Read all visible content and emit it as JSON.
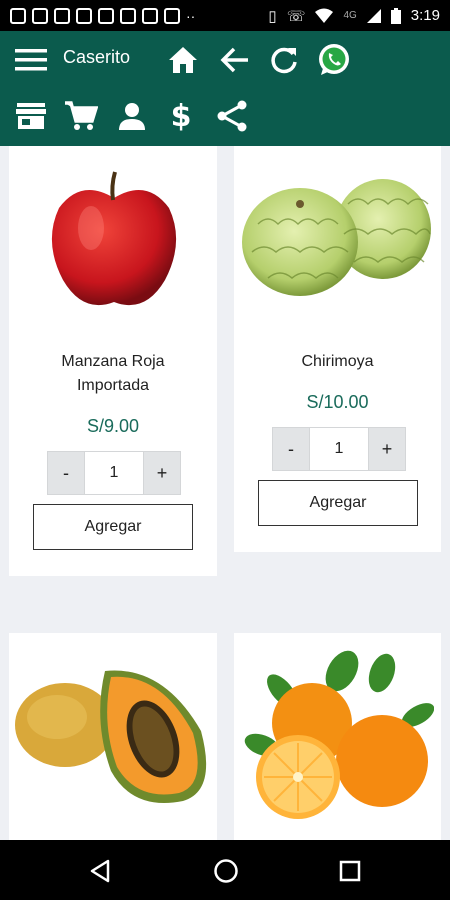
{
  "status_bar": {
    "time": "3:19",
    "network": "4G"
  },
  "header": {
    "title": "Caserito"
  },
  "products": [
    {
      "name": "Manzana Roja Importada",
      "price": "S/9.00",
      "qty": "1",
      "minus": "-",
      "plus": "+",
      "add_label": "Agregar"
    },
    {
      "name": "Chirimoya",
      "price": "S/10.00",
      "qty": "1",
      "minus": "-",
      "plus": "+",
      "add_label": "Agregar"
    },
    {
      "name": ""
    },
    {
      "name": ""
    }
  ],
  "colors": {
    "appbar": "#0b5b4d",
    "price": "#1a6b5b",
    "background": "#eef0f4"
  }
}
